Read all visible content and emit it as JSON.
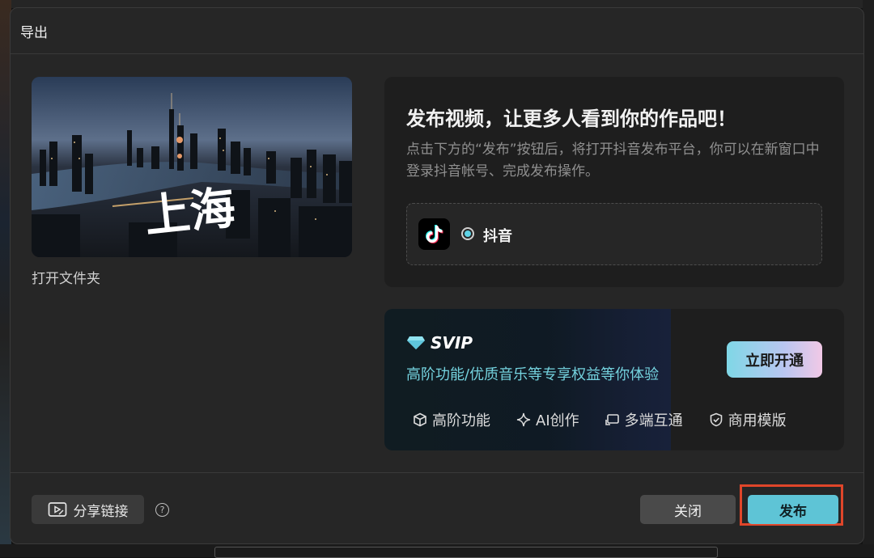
{
  "dialog": {
    "title": "导出",
    "open_folder": "打开文件夹",
    "preview_caption": "上海"
  },
  "publish": {
    "title": "发布视频，让更多人看到你的作品吧！",
    "description": "点击下方的“发布”按钮后，将打开抖音发布平台，你可以在新窗口中登录抖音帐号、完成发布操作。",
    "platform": {
      "name": "抖音",
      "selected": true,
      "icon": "tiktok-logo"
    }
  },
  "svip": {
    "badge": "SVIP",
    "subtitle": "高阶功能/优质音乐等专享权益等你体验",
    "open_button": "立即开通",
    "features": [
      {
        "label": "高阶功能",
        "icon": "cube-icon"
      },
      {
        "label": "AI创作",
        "icon": "sparkle-icon"
      },
      {
        "label": "多端互通",
        "icon": "cast-icon"
      },
      {
        "label": "商用模版",
        "icon": "shield-check-icon"
      }
    ],
    "accent_color": "#74d2de"
  },
  "footer": {
    "share_button": "分享链接",
    "help": "?",
    "close_button": "关闭",
    "publish_button": "发布",
    "highlight_color": "#e0462a",
    "publish_color": "#5ec4d6"
  }
}
